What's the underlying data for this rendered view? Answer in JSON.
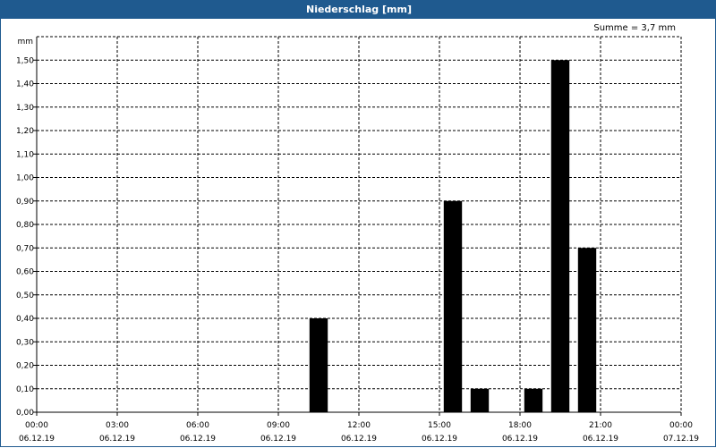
{
  "title": "Niederschlag [mm]",
  "summary": "Summe = 3,7 mm",
  "chart_data": {
    "type": "bar",
    "ylabel": "mm",
    "ylim": [
      0,
      1.6
    ],
    "yticks": [
      0,
      0.1,
      0.2,
      0.3,
      0.4,
      0.5,
      0.6,
      0.7,
      0.8,
      0.9,
      1.0,
      1.1,
      1.2,
      1.3,
      1.4,
      1.5
    ],
    "ytick_labels": [
      "0,00",
      "0,10",
      "0,20",
      "0,30",
      "0,40",
      "0,50",
      "0,60",
      "0,70",
      "0,80",
      "0,90",
      "1,00",
      "1,10",
      "1,20",
      "1,30",
      "1,40",
      "1,50"
    ],
    "xlim_hours": [
      0,
      24
    ],
    "xticks": [
      {
        "hour": 0,
        "time": "00:00",
        "date": "06.12.19"
      },
      {
        "hour": 3,
        "time": "03:00",
        "date": "06.12.19"
      },
      {
        "hour": 6,
        "time": "06:00",
        "date": "06.12.19"
      },
      {
        "hour": 9,
        "time": "09:00",
        "date": "06.12.19"
      },
      {
        "hour": 12,
        "time": "12:00",
        "date": "06.12.19"
      },
      {
        "hour": 15,
        "time": "15:00",
        "date": "06.12.19"
      },
      {
        "hour": 18,
        "time": "18:00",
        "date": "06.12.19"
      },
      {
        "hour": 21,
        "time": "21:00",
        "date": "06.12.19"
      },
      {
        "hour": 24,
        "time": "00:00",
        "date": "07.12.19"
      }
    ],
    "grid": true,
    "bars": [
      {
        "hour": 10,
        "value": 0.4
      },
      {
        "hour": 15,
        "value": 0.9
      },
      {
        "hour": 16,
        "value": 0.1
      },
      {
        "hour": 18,
        "value": 0.1
      },
      {
        "hour": 19,
        "value": 1.5
      },
      {
        "hour": 20,
        "value": 0.7
      }
    ],
    "bar_color": "#000000"
  }
}
